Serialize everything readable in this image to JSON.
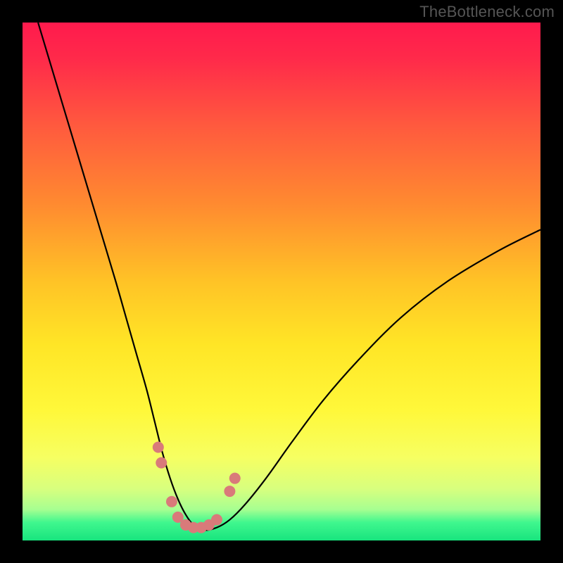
{
  "watermark": "TheBottleneck.com",
  "chart_data": {
    "type": "line",
    "title": "",
    "xlabel": "",
    "ylabel": "",
    "xlim": [
      0,
      100
    ],
    "ylim": [
      0,
      100
    ],
    "background_gradient_stops": [
      {
        "offset": 0.0,
        "color": "#ff1a4d"
      },
      {
        "offset": 0.07,
        "color": "#ff2a4a"
      },
      {
        "offset": 0.2,
        "color": "#ff5a3e"
      },
      {
        "offset": 0.35,
        "color": "#ff8a30"
      },
      {
        "offset": 0.5,
        "color": "#ffc326"
      },
      {
        "offset": 0.62,
        "color": "#ffe526"
      },
      {
        "offset": 0.75,
        "color": "#fff83a"
      },
      {
        "offset": 0.84,
        "color": "#f6ff62"
      },
      {
        "offset": 0.9,
        "color": "#d8ff7e"
      },
      {
        "offset": 0.94,
        "color": "#a7ff91"
      },
      {
        "offset": 0.965,
        "color": "#40f78e"
      },
      {
        "offset": 1.0,
        "color": "#18e47e"
      }
    ],
    "series": [
      {
        "name": "bottleneck-curve",
        "stroke": "#000000",
        "stroke_width": 2.2,
        "x": [
          3,
          6,
          9,
          12,
          15,
          18,
          20,
          22,
          24,
          25.5,
          27,
          28.5,
          30,
          31.5,
          33,
          35,
          37.5,
          40,
          43,
          47,
          52,
          58,
          65,
          73,
          82,
          92,
          100
        ],
        "y": [
          100,
          90,
          80,
          70,
          60,
          50,
          43,
          36,
          29,
          23,
          17,
          12,
          8,
          5,
          3,
          2,
          2.5,
          4,
          7,
          12,
          19,
          27,
          35,
          43,
          50,
          56,
          60
        ]
      }
    ],
    "markers": {
      "name": "highlight-dots",
      "fill": "#d97a7a",
      "r": 8,
      "points": [
        {
          "x": 26.2,
          "y": 18
        },
        {
          "x": 26.8,
          "y": 15
        },
        {
          "x": 28.8,
          "y": 7.5
        },
        {
          "x": 30.0,
          "y": 4.5
        },
        {
          "x": 31.5,
          "y": 3.0
        },
        {
          "x": 33.0,
          "y": 2.5
        },
        {
          "x": 34.5,
          "y": 2.5
        },
        {
          "x": 36.0,
          "y": 3.0
        },
        {
          "x": 37.5,
          "y": 4.0
        },
        {
          "x": 40.0,
          "y": 9.5
        },
        {
          "x": 41.0,
          "y": 12.0
        }
      ]
    }
  }
}
